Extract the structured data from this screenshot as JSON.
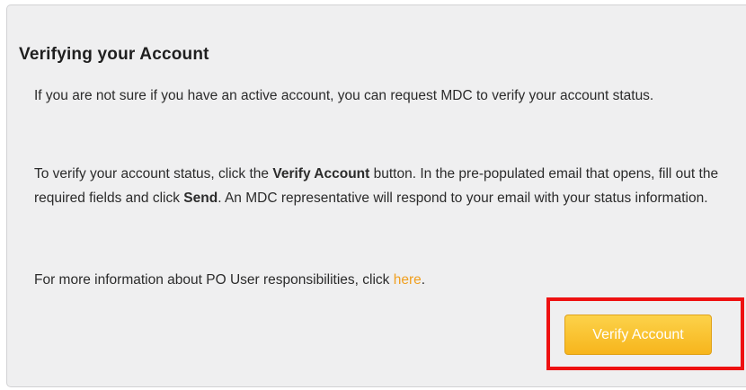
{
  "panel": {
    "title": "Verifying your Account",
    "paragraph1": "If you are not sure if you have an active account, you can request MDC to verify your account status.",
    "paragraph2": {
      "part1": "To verify your account status, click the ",
      "bold1": "Verify Account",
      "part2": " button. In the pre-populated email that opens, fill out the required fields and click ",
      "bold2": "Send",
      "part3": ". An MDC representative will respond to your email with your status information."
    },
    "paragraph3": {
      "text": "For more information about PO User responsibilities, click ",
      "link_label": "here",
      "after_link": "."
    },
    "verify_button_label": "Verify Account"
  },
  "colors": {
    "panel_background": "#efeff0",
    "link": "#f0a020",
    "button_gradient_top": "#fcd24a",
    "button_gradient_bottom": "#f7b51c",
    "highlight_border": "#ee1111"
  }
}
